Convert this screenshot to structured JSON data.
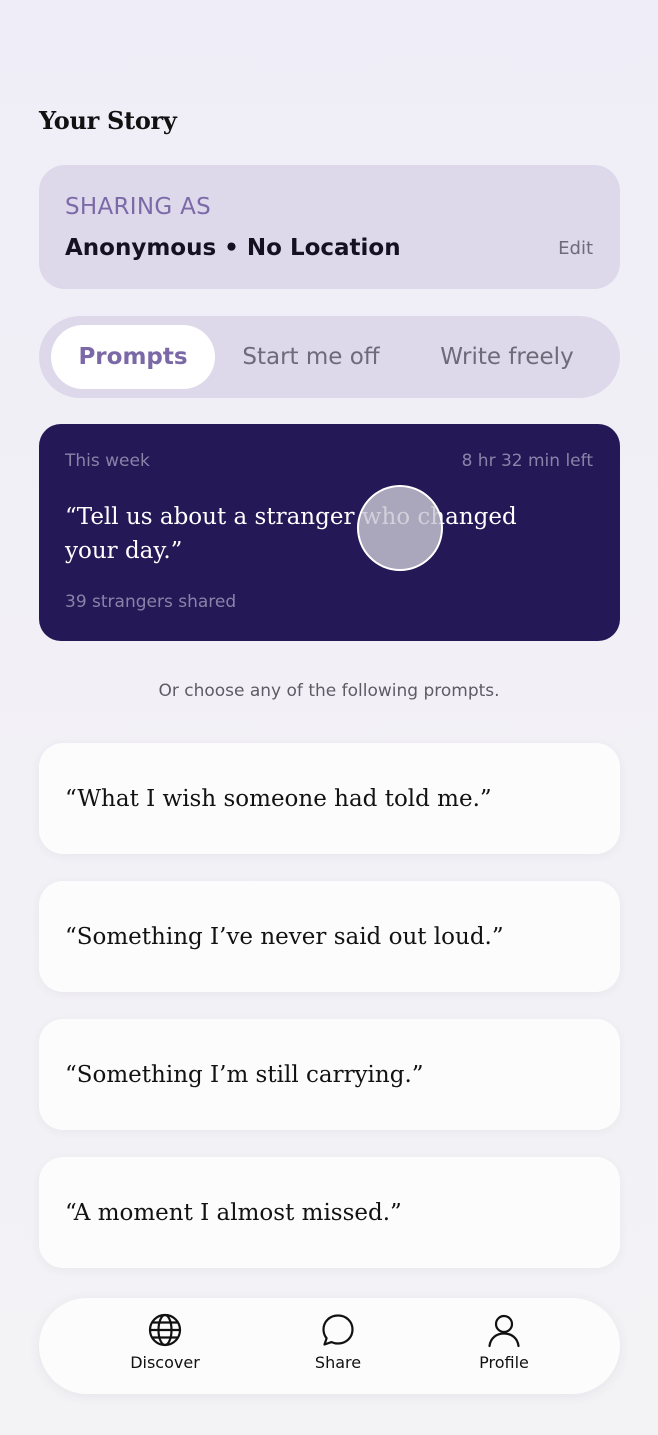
{
  "header": {
    "title": "Your Story"
  },
  "sharing": {
    "label": "SHARING AS",
    "value": "Anonymous • No Location",
    "edit_label": "Edit"
  },
  "tabs": [
    {
      "label": "Prompts",
      "active": true
    },
    {
      "label": "Start me off",
      "active": false
    },
    {
      "label": "Write freely",
      "active": false
    }
  ],
  "weekly": {
    "label": "This week",
    "time_left": "8 hr 32 min left",
    "prompt": "“Tell us about a stranger who changed your day.”",
    "shared_count": "39 strangers shared"
  },
  "hint": "Or choose any of the following prompts.",
  "prompts": [
    "“What I wish someone had told me.”",
    "“Something I’ve never said out loud.”",
    "“Something I’m still carrying.”",
    "“A moment I almost missed.”"
  ],
  "nav": [
    {
      "label": "Discover",
      "icon": "globe-icon"
    },
    {
      "label": "Share",
      "icon": "chat-bubble-icon"
    },
    {
      "label": "Profile",
      "icon": "person-icon"
    }
  ],
  "colors": {
    "accent": "#7b68a6",
    "card_dark": "#241856",
    "tint": "#ddd8ea"
  }
}
